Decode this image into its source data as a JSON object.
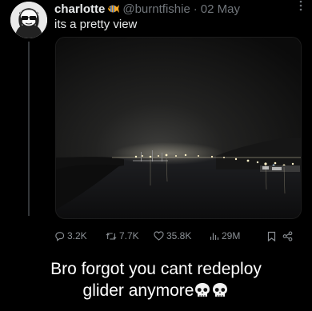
{
  "tweet": {
    "author_name": "charlotte",
    "author_emoji_icon": "tropical-fish-icon",
    "handle": "@burntfishie",
    "separator": "·",
    "date": "02 May",
    "text": "its a pretty view",
    "more_icon": "more-options-icon"
  },
  "actions": {
    "replies": "3.2K",
    "reposts": "7.7K",
    "likes": "35.8K",
    "views": "29M"
  },
  "caption": {
    "line1": "Bro forgot you cant redeploy",
    "line2": "glider anymore",
    "emoji_icon": "skull-icon"
  },
  "colors": {
    "background": "#000000",
    "text": "#e7e9ea",
    "muted": "#71767b",
    "accent_fish": "#f5a623"
  }
}
